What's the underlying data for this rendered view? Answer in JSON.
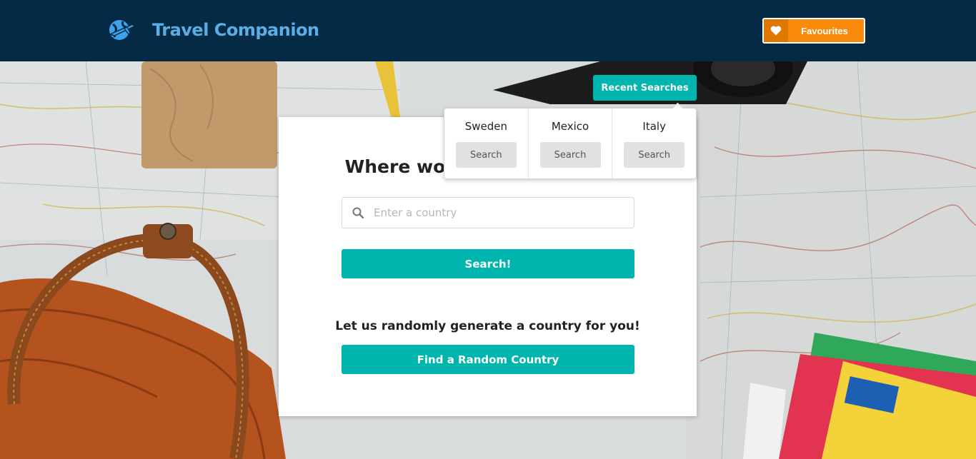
{
  "header": {
    "brand_title": "Travel Companion",
    "favourites_label": "Favourites",
    "brand_color": "#5aaee4",
    "accent_color": "#f98a0c"
  },
  "recent": {
    "toggle_label": "Recent Searches",
    "items": [
      {
        "country": "Sweden",
        "button": "Search"
      },
      {
        "country": "Mexico",
        "button": "Search"
      },
      {
        "country": "Italy",
        "button": "Search"
      }
    ]
  },
  "main": {
    "heading": "Where would you like to go?",
    "search_placeholder": "Enter a country",
    "search_value": "",
    "search_button": "Search!",
    "random_prompt": "Let us randomly generate a country for you!",
    "random_button": "Find a Random Country"
  },
  "icons": {
    "brand": "globe-plane-icon",
    "favourites": "heart-icon",
    "search": "search-icon"
  }
}
